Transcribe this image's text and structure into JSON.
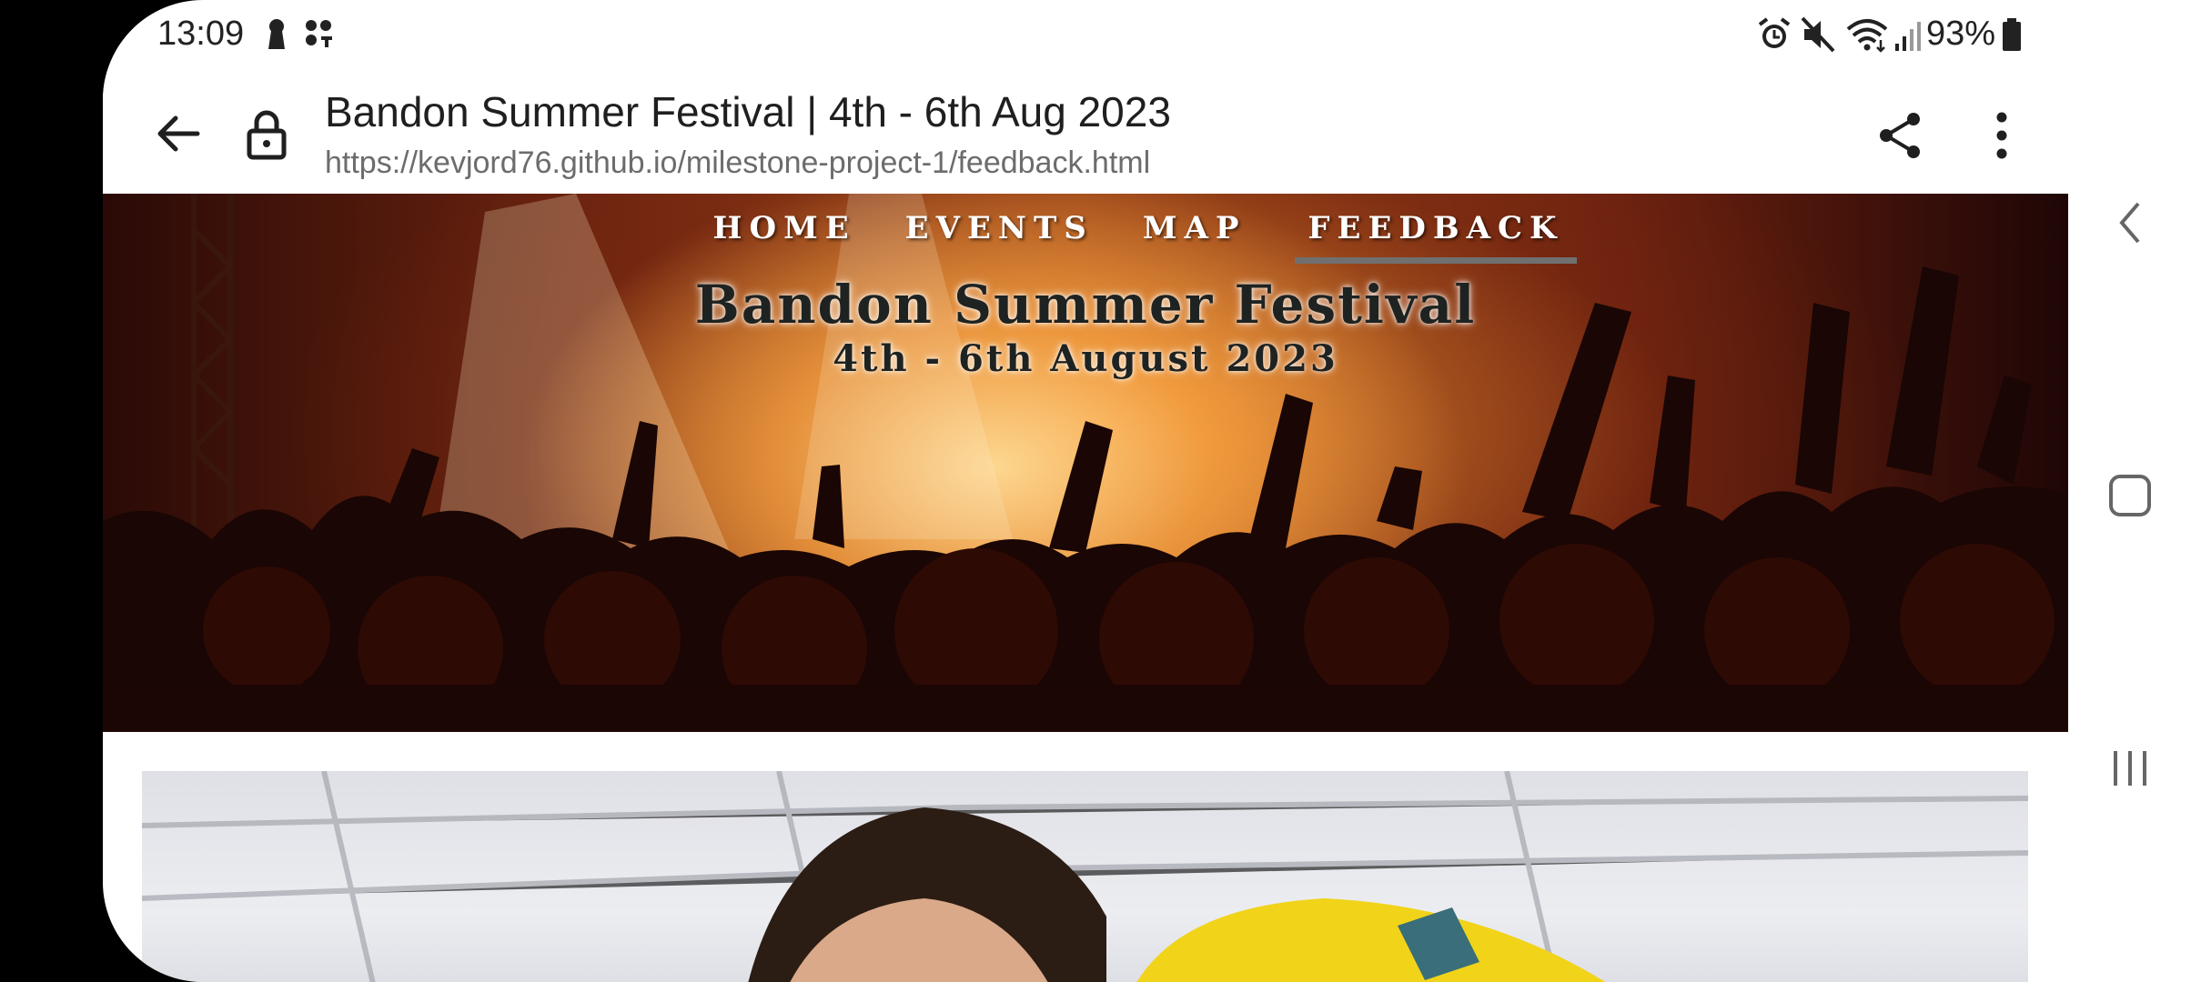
{
  "status_bar": {
    "time": "13:09",
    "battery": "93%",
    "icons": [
      "keyhole-icon",
      "notification-dots-icon",
      "alarm-icon",
      "mute-icon",
      "wifi-icon",
      "signal-icon",
      "battery-icon"
    ]
  },
  "browser": {
    "page_title": "Bandon Summer Festival | 4th - 6th Aug 2023",
    "url": "https://kevjord76.github.io/milestone-project-1/feedback.html",
    "icons": [
      "back-arrow-icon",
      "lock-icon",
      "share-icon",
      "more-vert-icon"
    ]
  },
  "site": {
    "nav": [
      {
        "label": "HOME",
        "active": false
      },
      {
        "label": "EVENTS",
        "active": false
      },
      {
        "label": "MAP",
        "active": false
      },
      {
        "label": "FEEDBACK",
        "active": true
      }
    ],
    "title": "Bandon Summer Festival",
    "dates": "4th - 6th August 2023"
  },
  "system_nav": {
    "icons": [
      "back-chevron-icon",
      "home-square-icon",
      "recents-icon"
    ]
  },
  "colors": {
    "active_underline": "#707070",
    "heading_text": "#1e2322"
  }
}
